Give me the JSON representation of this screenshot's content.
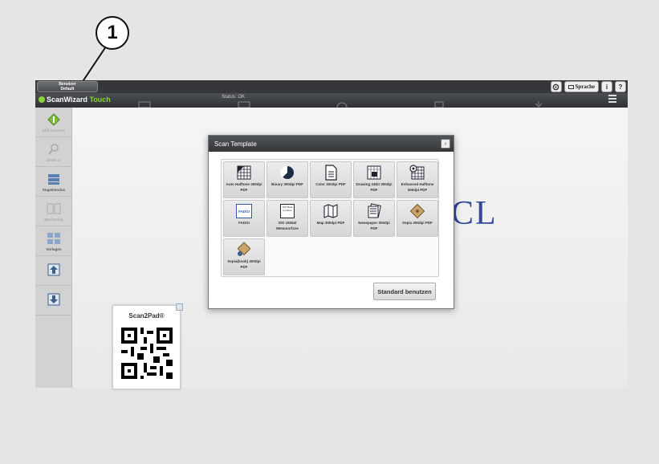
{
  "callout": {
    "number": "1"
  },
  "topbar": {
    "user_button_line1": "Benutzer",
    "user_button_line2": "Default",
    "language_label": "Sprache",
    "info_label": "i",
    "help_label": "?"
  },
  "toolbar": {
    "brand_name": "ScanWizard",
    "brand_suffix": "Touch",
    "status_text": "Status: OK"
  },
  "sidebar": {
    "items": [
      {
        "label": "Bild Scannen",
        "icon": "scan-diamond-icon",
        "dim": true
      },
      {
        "label": "Zoom in",
        "icon": "zoom-icon",
        "dim": true
      },
      {
        "label": "Stapelmodus",
        "icon": "stack-icon",
        "dim": false
      },
      {
        "label": "Monitoring",
        "icon": "monitor-icon",
        "dim": true
      },
      {
        "label": "Vorlagen",
        "icon": "templates-icon",
        "dim": false
      },
      {
        "label": "",
        "icon": "upload-icon",
        "dim": false
      },
      {
        "label": "",
        "icon": "download-icon",
        "dim": false
      }
    ]
  },
  "background_logo": "CL",
  "scan2pad": {
    "title": "Scan2Pad®"
  },
  "modal": {
    "title": "Scan Template",
    "close_label": "›",
    "templates": [
      {
        "label": "Auto Halftone 300dpi PDF",
        "icon": "halftone-grid-icon"
      },
      {
        "label": "Binary 300dpi PDF",
        "icon": "binary-circle-icon"
      },
      {
        "label": "Color 300dpi PDF",
        "icon": "document-icon"
      },
      {
        "label": "Drawing 24bit 300dpi PDF",
        "icon": "drawing-icon"
      },
      {
        "label": "Enhanced Halftone 300dpi PDF",
        "icon": "enhanced-halftone-icon"
      },
      {
        "label": "FADGI",
        "icon": "fadgi-icon"
      },
      {
        "label": "ISO 19264/ Metamorfoze",
        "icon": "iso-icon"
      },
      {
        "label": "Map 300dpi PDF",
        "icon": "map-icon"
      },
      {
        "label": "Newspaper 300dpi PDF",
        "icon": "newspaper-icon"
      },
      {
        "label": "Sepia 300dpi PDF",
        "icon": "sepia-icon"
      },
      {
        "label": "Sepia(book) 300dpi PDF",
        "icon": "sepia-book-icon"
      }
    ],
    "standard_button": "Standard benutzen",
    "fadgi_icon_text": "FADGI",
    "iso_icon_text": "ISO Meta morfoze"
  }
}
